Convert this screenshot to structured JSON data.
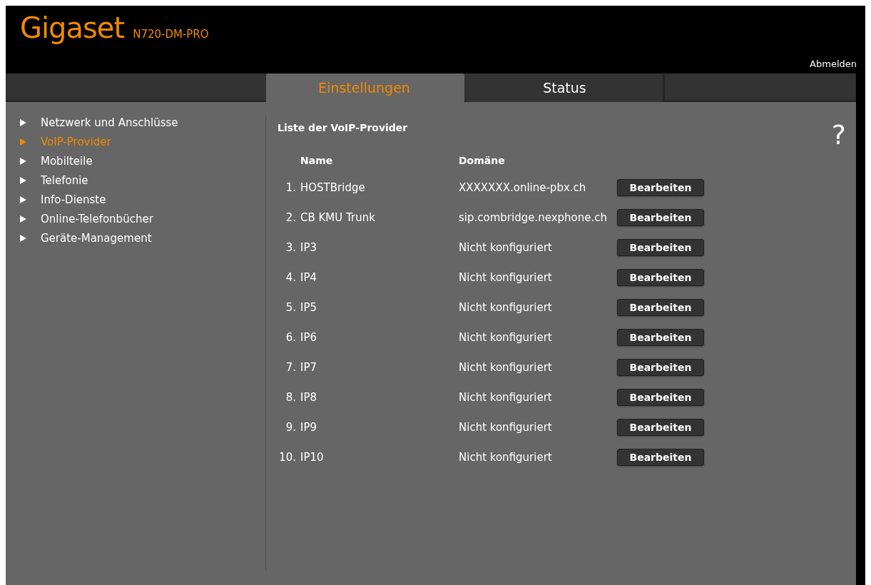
{
  "header": {
    "logo": "Gigaset",
    "model": "N720-DM-PRO",
    "logout": "Abmelden"
  },
  "tabs": [
    {
      "label": "Einstellungen",
      "selected": true
    },
    {
      "label": "Status",
      "selected": false
    }
  ],
  "sidebar": {
    "items": [
      {
        "label": "Netzwerk und Anschlüsse",
        "selected": false
      },
      {
        "label": "VoIP-Provider",
        "selected": true
      },
      {
        "label": "Mobilteile",
        "selected": false
      },
      {
        "label": "Telefonie",
        "selected": false
      },
      {
        "label": "Info-Dienste",
        "selected": false
      },
      {
        "label": "Online-Telefonbücher",
        "selected": false
      },
      {
        "label": "Geräte-Management",
        "selected": false
      }
    ]
  },
  "content": {
    "title": "Liste der VoIP-Provider",
    "help": "?",
    "columns": [
      "Name",
      "Domäne"
    ],
    "rows": [
      {
        "index": "1.",
        "name": "HOSTBridge",
        "domain": "XXXXXXX.online-pbx.ch",
        "action": "Bearbeiten"
      },
      {
        "index": "2.",
        "name": "CB KMU Trunk",
        "domain": "sip.combridge.nexphone.ch",
        "action": "Bearbeiten"
      },
      {
        "index": "3.",
        "name": "IP3",
        "domain": "Nicht konfiguriert",
        "action": "Bearbeiten"
      },
      {
        "index": "4.",
        "name": "IP4",
        "domain": "Nicht konfiguriert",
        "action": "Bearbeiten"
      },
      {
        "index": "5.",
        "name": "IP5",
        "domain": "Nicht konfiguriert",
        "action": "Bearbeiten"
      },
      {
        "index": "6.",
        "name": "IP6",
        "domain": "Nicht konfiguriert",
        "action": "Bearbeiten"
      },
      {
        "index": "7.",
        "name": "IP7",
        "domain": "Nicht konfiguriert",
        "action": "Bearbeiten"
      },
      {
        "index": "8.",
        "name": "IP8",
        "domain": "Nicht konfiguriert",
        "action": "Bearbeiten"
      },
      {
        "index": "9.",
        "name": "IP9",
        "domain": "Nicht konfiguriert",
        "action": "Bearbeiten"
      },
      {
        "index": "10.",
        "name": "IP10",
        "domain": "Nicht konfiguriert",
        "action": "Bearbeiten"
      }
    ]
  }
}
